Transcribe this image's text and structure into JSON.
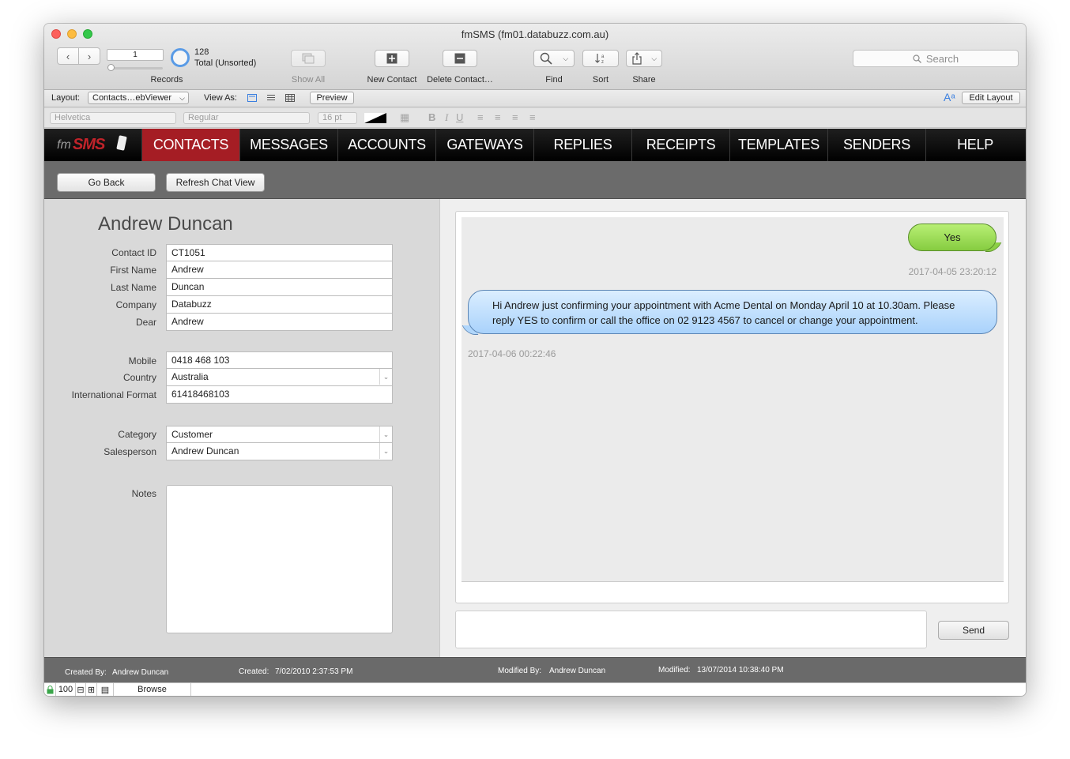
{
  "window": {
    "title": "fmSMS (fm01.databuzz.com.au)"
  },
  "toolbar": {
    "record_current": "1",
    "record_count": "128",
    "record_status": "Total (Unsorted)",
    "records_label": "Records",
    "show_all_label": "Show All",
    "new_label": "New Contact",
    "delete_label": "Delete Contact…",
    "find_label": "Find",
    "sort_label": "Sort",
    "share_label": "Share",
    "search_placeholder": "Search"
  },
  "layoutbar": {
    "layout_label": "Layout:",
    "layout_value": "Contacts…ebViewer",
    "view_as_label": "View As:",
    "preview_label": "Preview",
    "edit_layout_label": "Edit Layout"
  },
  "formatbar": {
    "font": "Helvetica",
    "style": "Regular",
    "size": "16 pt"
  },
  "nav": {
    "logo_fm": "fm",
    "logo_sms": "SMS",
    "items": [
      "CONTACTS",
      "MESSAGES",
      "ACCOUNTS",
      "GATEWAYS",
      "REPLIES",
      "RECEIPTS",
      "TEMPLATES",
      "SENDERS",
      "HELP"
    ],
    "active": "CONTACTS"
  },
  "subbar": {
    "go_back": "Go Back",
    "refresh": "Refresh Chat View"
  },
  "contact": {
    "name": "Andrew Duncan",
    "fields": {
      "contact_id": {
        "label": "Contact ID",
        "value": "CT1051"
      },
      "first_name": {
        "label": "First Name",
        "value": "Andrew"
      },
      "last_name": {
        "label": "Last Name",
        "value": "Duncan"
      },
      "company": {
        "label": "Company",
        "value": "Databuzz"
      },
      "dear": {
        "label": "Dear",
        "value": "Andrew"
      },
      "mobile": {
        "label": "Mobile",
        "value": "0418 468 103"
      },
      "country": {
        "label": "Country",
        "value": "Australia"
      },
      "intl": {
        "label": "International Format",
        "value": "61418468103"
      },
      "category": {
        "label": "Category",
        "value": "Customer"
      },
      "salesperson": {
        "label": "Salesperson",
        "value": "Andrew Duncan"
      },
      "notes": {
        "label": "Notes",
        "value": ""
      }
    }
  },
  "chat": {
    "messages": [
      {
        "text": "Yes",
        "timestamp": "2017-04-05 23:20:12",
        "direction": "incoming",
        "color": "#8fd14a"
      },
      {
        "text": "Hi Andrew just confirming your appointment with Acme Dental on Monday April 10 at 10.30am. Please reply YES to confirm or call the office on 02 9123 4567 to cancel or change your appointment.",
        "timestamp": "2017-04-06 00:22:46",
        "direction": "outgoing",
        "color": "#bcdcfc"
      }
    ],
    "send_label": "Send"
  },
  "footer": {
    "created_by_label": "Created By:",
    "created_by": "Andrew Duncan",
    "created_label": "Created:",
    "created": "7/02/2010 2:37:53 PM",
    "modified_by_label": "Modified By:",
    "modified_by": "Andrew Duncan",
    "modified_label": "Modified:",
    "modified": "13/07/2014 10:38:40 PM"
  },
  "statusbar": {
    "zoom": "100",
    "mode": "Browse"
  },
  "colors": {
    "nav_active": "#a51d24",
    "nav_bg": "#000000",
    "accent_blue": "#5a9be6"
  }
}
